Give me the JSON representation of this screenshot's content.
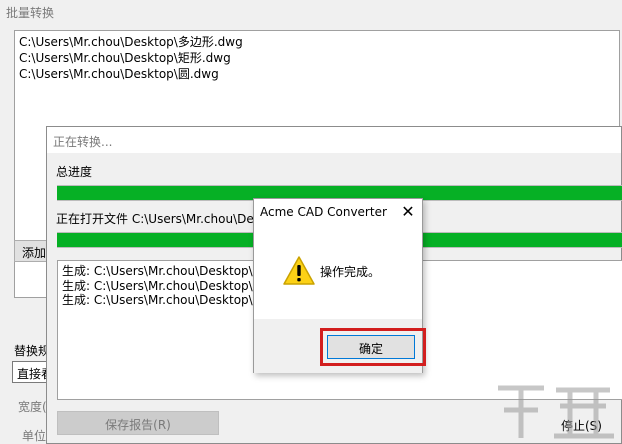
{
  "batch": {
    "title": "批量转换",
    "files": [
      "C:\\Users\\Mr.chou\\Desktop\\多边形.dwg",
      "C:\\Users\\Mr.chou\\Desktop\\矩形.dwg",
      "C:\\Users\\Mr.chou\\Desktop\\圆.dwg"
    ],
    "add_label": "添加",
    "replace_label": "替换规",
    "replace_value": "直接看",
    "width_label": "宽度(",
    "unit_label": "单位"
  },
  "progress": {
    "title": "正在转换...",
    "total_label": "总进度",
    "total_progress": 1.0,
    "file_label": "正在打开文件 C:\\Users\\Mr.chou\\Desk",
    "file_progress": 1.0,
    "log": [
      "生成: C:\\Users\\Mr.chou\\Desktop\\转",
      "生成: C:\\Users\\Mr.chou\\Desktop\\转",
      "生成: C:\\Users\\Mr.chou\\Desktop\\转"
    ],
    "save_report_label": "保存报告(R)",
    "stop_label": "停止(S)",
    "bar_color": "#06b025"
  },
  "msgbox": {
    "title": "Acme CAD Converter",
    "message": "操作完成。",
    "ok_label": "确定",
    "icon": "warning-icon",
    "highlight_color": "#d21e1e"
  }
}
